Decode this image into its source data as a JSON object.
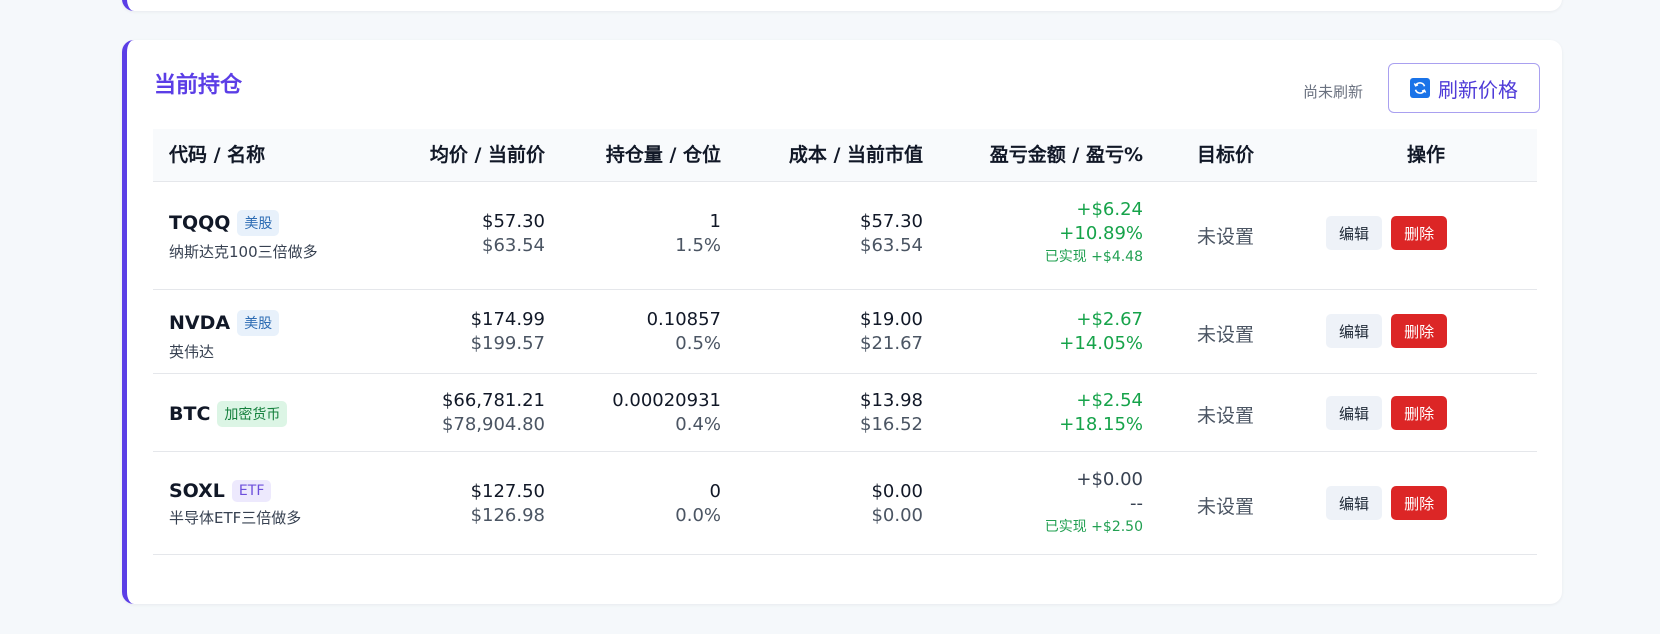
{
  "section": {
    "title": "当前持仓",
    "refresh_status": "尚未刷新",
    "refresh_button": "刷新价格",
    "refresh_icon": "refresh-icon"
  },
  "table": {
    "headers": [
      "代码 / 名称",
      "均价 / 当前价",
      "持仓量 / 仓位",
      "成本 / 当前市值",
      "盈亏金额 / 盈亏%",
      "目标价",
      "操作"
    ],
    "rows": [
      {
        "symbol": "TQQQ",
        "badge": "美股",
        "name": "纳斯达克100三倍做多",
        "avg_price": "$57.30",
        "current_price": "$63.54",
        "quantity": "1",
        "position": "1.5%",
        "cost": "$57.30",
        "market_value": "$63.54",
        "pl_amount": "+$6.24",
        "pl_percent": "+10.89%",
        "realized": "已实现 +$4.48",
        "target": "未设置",
        "edit": "编辑",
        "delete": "删除"
      },
      {
        "symbol": "NVDA",
        "badge": "美股",
        "name": "英伟达",
        "avg_price": "$174.99",
        "current_price": "$199.57",
        "quantity": "0.10857",
        "position": "0.5%",
        "cost": "$19.00",
        "market_value": "$21.67",
        "pl_amount": "+$2.67",
        "pl_percent": "+14.05%",
        "target": "未设置",
        "edit": "编辑",
        "delete": "删除"
      },
      {
        "symbol": "BTC",
        "badge": "加密货币",
        "avg_price": "$66,781.21",
        "current_price": "$78,904.80",
        "quantity": "0.00020931",
        "position": "0.4%",
        "cost": "$13.98",
        "market_value": "$16.52",
        "pl_amount": "+$2.54",
        "pl_percent": "+18.15%",
        "target": "未设置",
        "edit": "编辑",
        "delete": "删除"
      },
      {
        "symbol": "SOXL",
        "badge": "ETF",
        "name": "半导体ETF三倍做多",
        "avg_price": "$127.50",
        "current_price": "$126.98",
        "quantity": "0",
        "position": "0.0%",
        "cost": "$0.00",
        "market_value": "$0.00",
        "pl_amount": "+$0.00",
        "pl_percent": "--",
        "realized": "已实现 +$2.50",
        "target": "未设置",
        "edit": "编辑",
        "delete": "删除"
      }
    ]
  },
  "colors": {
    "accent": "#5b3ee6",
    "profit": "#16a34a",
    "delete": "#dc2626"
  }
}
